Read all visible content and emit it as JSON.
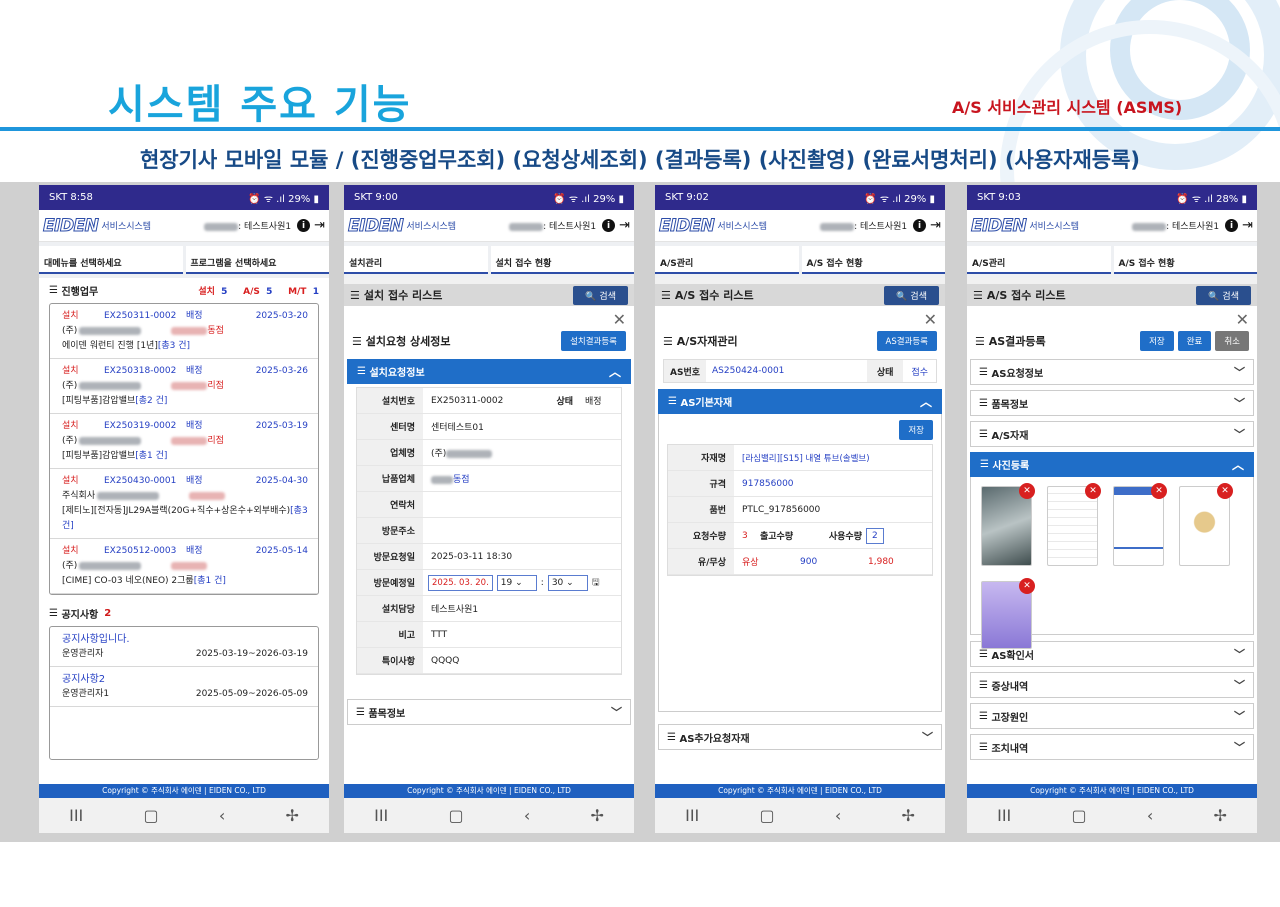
{
  "slide": {
    "title": "시스템 주요 기능",
    "system": "A/S 서비스관리 시스템 (ASMS)",
    "caption": "현장기사 모바일 모듈 / (진행중업무조회) (요청상세조회) (결과등록) (사진촬영) (완료서명처리) (사용자재등록)"
  },
  "common": {
    "logo": "EIDEN",
    "service": "서비스시스템",
    "user": ": 테스트사원1",
    "footer": "Copyright © 주식회사 에이덴 | EIDEN CO., LTD",
    "nav": [
      "III",
      "▢",
      "‹",
      "✢"
    ],
    "close": "✕",
    "search": "🔍 검색"
  },
  "phones": [
    {
      "status_time": "SKT 8:58",
      "status_right": "29%",
      "menu": [
        "대메뉴를 선택하세요",
        "프로그램을 선택하세요"
      ]
    },
    {
      "status_time": "SKT 9:00",
      "status_right": "29%",
      "menu": [
        "설치관리",
        "설치 접수 현황"
      ]
    },
    {
      "status_time": "SKT 9:02",
      "status_right": "29%",
      "menu": [
        "A/S관리",
        "A/S 접수 현황"
      ]
    },
    {
      "status_time": "SKT 9:03",
      "status_right": "28%",
      "menu": [
        "A/S관리",
        "A/S 접수 현황"
      ]
    }
  ],
  "p1": {
    "progress_title": "진행업무",
    "counts": [
      {
        "label": "설치",
        "value": "5"
      },
      {
        "label": "A/S",
        "value": "5"
      },
      {
        "label": "M/T",
        "value": "1"
      }
    ],
    "jobs": [
      {
        "type": "설치",
        "no": "EX250311-0002",
        "status": "배정",
        "date": "2025-03-20",
        "company": "(주)",
        "suffix": "동점",
        "desc": "에이덴 워런티 진행 [1년]",
        "count": "[총3 건]"
      },
      {
        "type": "설치",
        "no": "EX250318-0002",
        "status": "배정",
        "date": "2025-03-26",
        "company": "(주)",
        "suffix": "리점",
        "desc": "[피팅부품]감압밸브",
        "count": "[총2 건]"
      },
      {
        "type": "설치",
        "no": "EX250319-0002",
        "status": "배정",
        "date": "2025-03-19",
        "company": "(주)",
        "suffix": "리점",
        "desc": "[피팅부품]감압밸브",
        "count": "[총1 건]"
      },
      {
        "type": "설치",
        "no": "EX250430-0001",
        "status": "배정",
        "date": "2025-04-30",
        "company": "주식회사",
        "suffix": "",
        "desc": "[제티노][전자동]JL29A블랙(20G+직수+상온수+외부배수)",
        "count": "[총3 건]"
      },
      {
        "type": "설치",
        "no": "EX250512-0003",
        "status": "배정",
        "date": "2025-05-14",
        "company": "(주)",
        "suffix": "",
        "desc": "[CIME] CO-03 네오(NEO) 2그룹",
        "count": "[총1 건]"
      }
    ],
    "notice_title": "공지사항",
    "notice_count": "2",
    "notices": [
      {
        "title": "공지사항입니다.",
        "author": "운영관리자",
        "period": "2025-03-19~2026-03-19"
      },
      {
        "title": "공지사항2",
        "author": "운영관리자1",
        "period": "2025-05-09~2026-05-09"
      }
    ]
  },
  "p2": {
    "list_title": "설치 접수 리스트",
    "modal_title": "설치요청 상세정보",
    "modal_btn": "설치결과등록",
    "panel": "설치요청정보",
    "fields": {
      "no_label": "설치번호",
      "no": "EX250311-0002",
      "state_label": "상태",
      "state": "배정",
      "center_label": "센터명",
      "center": "센터테스트01",
      "company_label": "업체명",
      "company": "(주)",
      "vendor_label": "납품업체",
      "vendor": "동점",
      "contact_label": "연락처",
      "addr_label": "방문주소",
      "req_label": "방문요청일",
      "req": "2025-03-11 18:30",
      "plan_label": "방문예정일",
      "plan_date": "2025. 03. 20.",
      "plan_h": "19",
      "plan_m": "30",
      "owner_label": "설치담당",
      "owner": "테스트사원1",
      "note_label": "비고",
      "note": "TTT",
      "spec_label": "특이사항",
      "spec": "QQQQ"
    },
    "collapse": "품목정보"
  },
  "p3": {
    "list_title": "A/S 접수 리스트",
    "modal_title": "A/S자재관리",
    "modal_btn": "AS결과등록",
    "as_label": "AS번호",
    "as_no": "AS250424-0001",
    "state_label": "상태",
    "state": "접수",
    "panel": "AS기본자재",
    "save": "저장",
    "fields": {
      "mat_label": "자재명",
      "mat": "[라심밸리][S15] 내열 튜브(솔벨브)",
      "spec_label": "규격",
      "spec": "917856000",
      "part_label": "품번",
      "part": "PTLC_917856000",
      "reqq_label": "요청수량",
      "reqq": "3",
      "outq_label": "출고수량",
      "useq_label": "사용수량",
      "useq": "2",
      "paid_label": "유/무상",
      "paid": "유상",
      "price": "900",
      "total": "1,980"
    },
    "collapse": "AS추가요청자재"
  },
  "p4": {
    "list_title": "A/S 접수 리스트",
    "modal_title": "AS결과등록",
    "btn_save": "저장",
    "btn_done": "완료",
    "btn_cancel": "취소",
    "sections": [
      "AS요청정보",
      "품목정보",
      "A/S자재"
    ],
    "photo_panel": "사진등록",
    "sections2": [
      "AS확인서",
      "증상내역",
      "고장원인",
      "조치내역"
    ]
  }
}
